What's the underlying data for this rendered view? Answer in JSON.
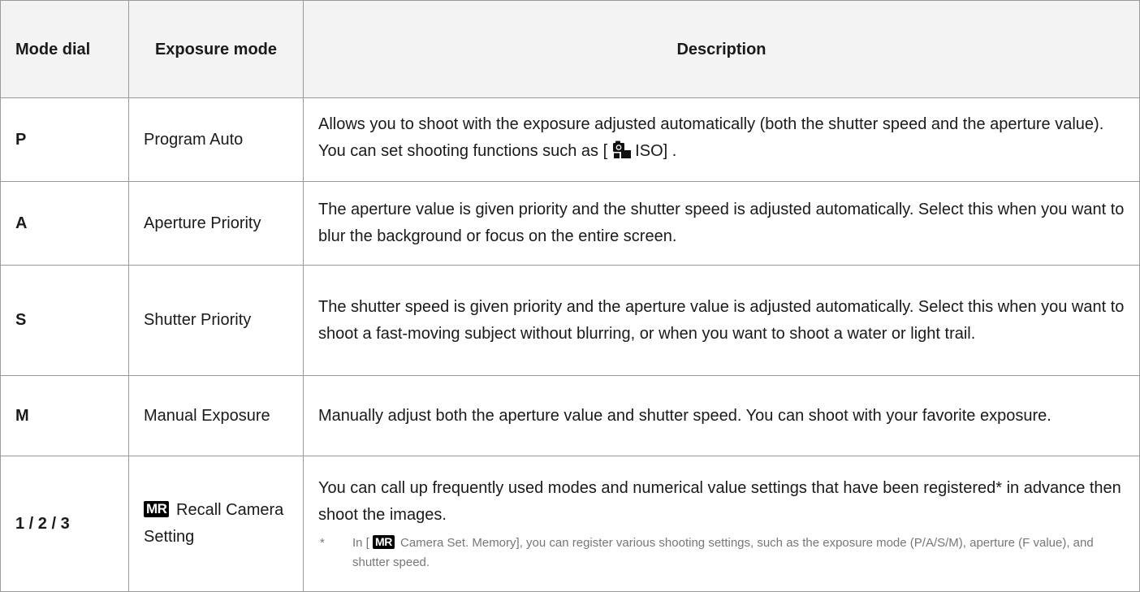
{
  "table": {
    "headers": {
      "mode_dial": "Mode dial",
      "exposure_mode": "Exposure mode",
      "description": "Description"
    },
    "rows": [
      {
        "dial": "P",
        "mode": "Program Auto",
        "desc_before_icon": "Allows you to shoot with the exposure adjusted automatically (both the shutter speed and the aperture value). You can set shooting functions such as [",
        "desc_after_icon": "ISO] ."
      },
      {
        "dial": "A",
        "mode": "Aperture Priority",
        "desc": "The aperture value is given priority and the shutter speed is adjusted automatically. Select this when you want to blur the background or focus on the entire screen."
      },
      {
        "dial": "S",
        "mode": "Shutter Priority",
        "desc": "The shutter speed is given priority and the aperture value is adjusted automatically. Select this when you want to shoot a fast-moving subject without blurring, or when you want to shoot a water or light trail."
      },
      {
        "dial": "M",
        "mode": "Manual Exposure",
        "desc": "Manually adjust both the aperture value and shutter speed. You can shoot with your favorite exposure."
      },
      {
        "dial_1": "1",
        "dial_sep": " / ",
        "dial_2": "2",
        "dial_3": "3",
        "mode_badge": "MR",
        "mode": "Recall Camera Setting",
        "desc": "You can call up frequently used modes and numerical value settings that have been registered* in advance then shoot the images.",
        "note_mark": "*",
        "note_before_badge": "In [",
        "note_badge": "MR",
        "note_after_badge": "Camera Set. Memory], you can register various shooting settings, such as the exposure mode (P/A/S/M), aperture (F value), and shutter speed."
      }
    ]
  },
  "icons": {
    "camera_iso": "camera-still-icon"
  }
}
